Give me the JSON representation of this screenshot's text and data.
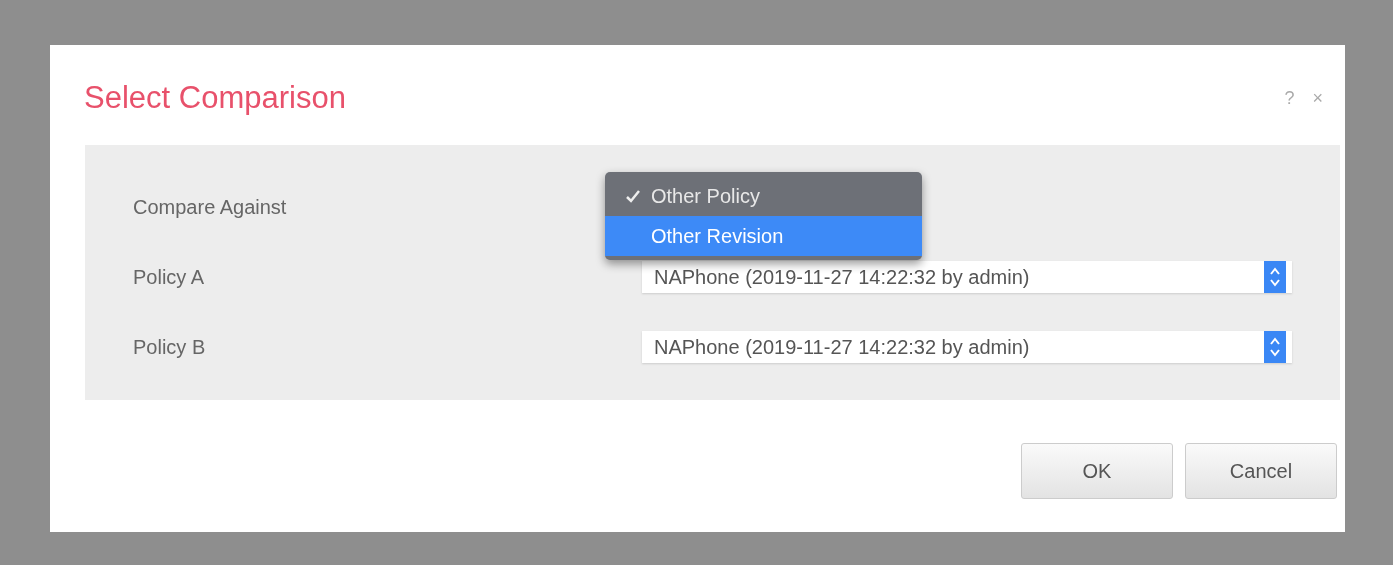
{
  "dialog": {
    "title": "Select Comparison",
    "help_icon": "?",
    "close_icon": "×"
  },
  "form": [
    {
      "label": "Compare Against",
      "kind": "menu"
    },
    {
      "label": "Policy A",
      "kind": "select",
      "value": "NAPhone (2019-11-27 14:22:32 by admin)"
    },
    {
      "label": "Policy B",
      "kind": "select",
      "value": "NAPhone (2019-11-27 14:22:32 by admin)"
    }
  ],
  "menu": [
    {
      "label": "Other Policy",
      "checked": true,
      "highlighted": false
    },
    {
      "label": "Other Revision",
      "checked": false,
      "highlighted": true
    }
  ],
  "buttons": [
    "OK",
    "Cancel"
  ]
}
